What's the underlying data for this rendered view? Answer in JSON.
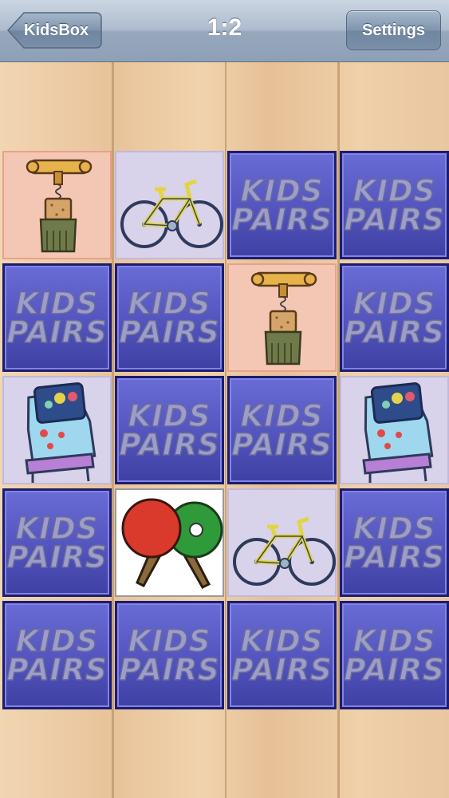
{
  "navbar": {
    "back_label": "KidsBox",
    "score": "1:2",
    "settings_label": "Settings"
  },
  "card_back": {
    "line1": "KIDS",
    "line2": "PAIRS"
  },
  "grid": {
    "rows": 5,
    "cols": 4,
    "cards": [
      [
        "corkscrew",
        "bicycle",
        "back",
        "back"
      ],
      [
        "back",
        "back",
        "corkscrew",
        "back"
      ],
      [
        "pinball",
        "back",
        "back",
        "pinball"
      ],
      [
        "back",
        "ping-pong",
        "bicycle",
        "back"
      ],
      [
        "back",
        "back",
        "back",
        "back"
      ]
    ]
  },
  "colors": {
    "card_back": "#5556c0",
    "card_border": "#1c1d6f",
    "matched_card": "#f4c7b4",
    "revealed_card": "#d8d2ea",
    "navbar": "#aebccd"
  }
}
